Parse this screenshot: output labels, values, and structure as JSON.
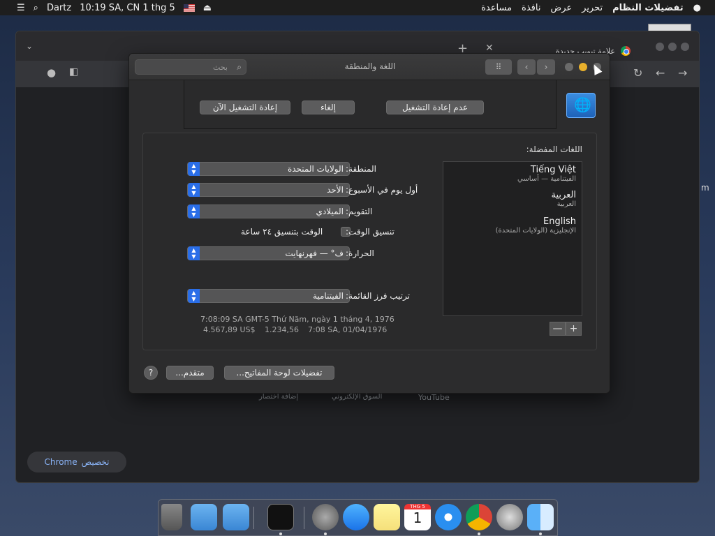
{
  "menubar": {
    "left": {
      "user": "Dartz",
      "clock": "10:19 SA, CN 1 thg 5",
      "icons": [
        "list-icon",
        "search-icon",
        "flag-icon",
        "eject-icon"
      ]
    },
    "right": {
      "app_name": "تفضيلات النظام",
      "items": [
        "تحرير",
        "عرض",
        "نافذة",
        "مساعدة"
      ],
      "apple_icon": "apple-icon"
    }
  },
  "chrome": {
    "tab_title": "علامة تبويب جديدة",
    "shortcuts": [
      "إضافة اختصار",
      "السوق الإلكتروني",
      "YouTube"
    ],
    "customize_label": "تخصيص",
    "customize_brand": "Chrome"
  },
  "prefs": {
    "title": "اللغة والمنطقة",
    "search_placeholder": "بحث",
    "sheet": {
      "restart_now": "إعادة التشغيل الآن",
      "cancel": "إلغاء",
      "dont_restart": "عدم إعادة التشغيل"
    },
    "preferred_languages_heading": "اللغات المفضلة:",
    "languages": [
      {
        "name": "Tiếng Việt",
        "sub": "الفيتنامية — أساسي"
      },
      {
        "name": "العربية",
        "sub": "العربية"
      },
      {
        "name": "English",
        "sub": "الإنجليزية (الولايات المتحدة)"
      }
    ],
    "settings": {
      "region_label": "المنطقة:",
      "region_value": "الولايات المتحدة",
      "first_day_label": "أول يوم في الأسبوع:",
      "first_day_value": "الأحد",
      "calendar_label": "التقويم:",
      "calendar_value": "الميلادي",
      "time_format_label": "تنسيق الوقت:",
      "time_format_checkbox": "الوقت بتنسيق ٢٤ ساعة",
      "time_format_checked": false,
      "temperature_label": "الحرارة:",
      "temperature_value": "ف° — فهرنهايت",
      "sort_order_label": "ترتيب فرز القائمة:",
      "sort_order_value": "الفيتنامية"
    },
    "samples": {
      "line1": "7:08:09 SA GMT-5 Thứ Năm, ngày 1 tháng 4, 1976",
      "currency": "4.567,89 US$",
      "number": "1.234,56",
      "short_date": "7:08 SA, 01/04/1976"
    },
    "buttons": {
      "keyboard_prefs": "تفضيلات لوحة المفاتيح...",
      "advanced": "متقدم...",
      "help": "?",
      "add": "+",
      "remove": "—"
    }
  },
  "dock": {
    "items": [
      "trash-icon",
      "downloads-folder-icon",
      "applications-folder-icon",
      "terminal-icon",
      "system-preferences-icon",
      "app-store-icon",
      "notes-icon",
      "calendar-icon",
      "safari-icon",
      "chrome-icon",
      "launchpad-icon",
      "finder-icon"
    ],
    "calendar_month": "THG 5",
    "calendar_day": "1"
  },
  "side_text": "m"
}
